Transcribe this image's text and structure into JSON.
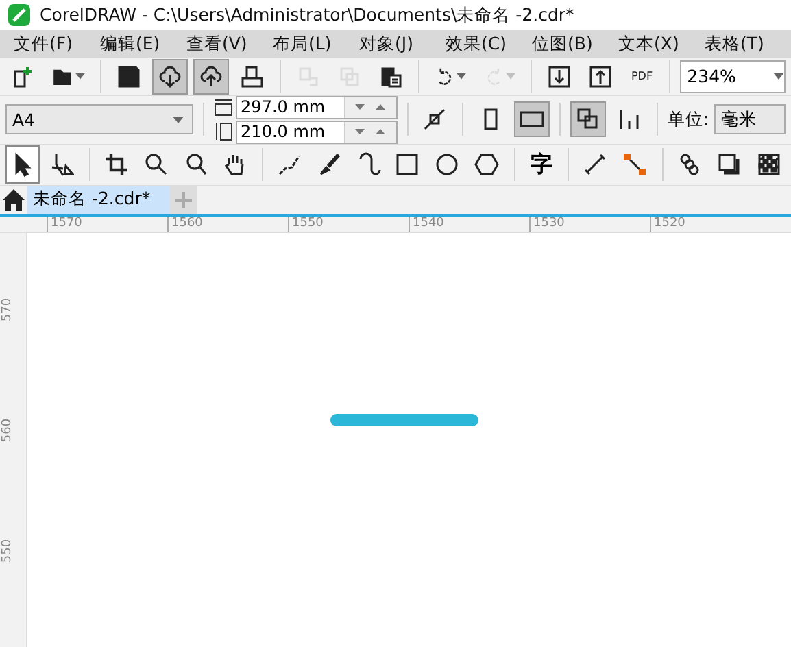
{
  "window": {
    "title": "CorelDRAW - C:\\Users\\Administrator\\Documents\\未命名 -2.cdr*"
  },
  "menu": [
    "文件(F)",
    "编辑(E)",
    "查看(V)",
    "布局(L)",
    "对象(J)",
    "效果(C)",
    "位图(B)",
    "文本(X)",
    "表格(T)"
  ],
  "standard_toolbar": [
    {
      "kind": "new",
      "selected": false,
      "disabled": false
    },
    {
      "kind": "open",
      "selected": false,
      "disabled": false,
      "dropdown": true
    },
    {
      "kind": "sep"
    },
    {
      "kind": "save",
      "selected": false,
      "disabled": false
    },
    {
      "kind": "download",
      "selected": true,
      "disabled": false
    },
    {
      "kind": "upload",
      "selected": true,
      "disabled": false
    },
    {
      "kind": "print",
      "selected": false,
      "disabled": false
    },
    {
      "kind": "sep"
    },
    {
      "kind": "cut",
      "selected": false,
      "disabled": true
    },
    {
      "kind": "copy",
      "selected": false,
      "disabled": true
    },
    {
      "kind": "paste",
      "selected": false,
      "disabled": false
    },
    {
      "kind": "sep"
    },
    {
      "kind": "undo",
      "selected": false,
      "disabled": false,
      "dropdown": true
    },
    {
      "kind": "redo",
      "selected": false,
      "disabled": true,
      "dropdown": true
    },
    {
      "kind": "sep"
    },
    {
      "kind": "import",
      "selected": false,
      "disabled": false
    },
    {
      "kind": "export",
      "selected": false,
      "disabled": false
    },
    {
      "kind": "pdf",
      "selected": false,
      "disabled": false,
      "label": "PDF"
    }
  ],
  "zoom": {
    "value": "234%"
  },
  "property_bar": {
    "page_size": "A4",
    "width": "297.0 mm",
    "height": "210.0 mm",
    "unit_label": "单位:",
    "unit_value": "毫米"
  },
  "toolbox": [
    {
      "kind": "pick",
      "selected": true
    },
    {
      "kind": "shape",
      "selected": false
    },
    {
      "kind": "sep"
    },
    {
      "kind": "crop",
      "selected": false
    },
    {
      "kind": "zoom",
      "selected": false
    },
    {
      "kind": "zoom2",
      "selected": false
    },
    {
      "kind": "pan",
      "selected": false
    },
    {
      "kind": "sep"
    },
    {
      "kind": "curve",
      "selected": false
    },
    {
      "kind": "brush",
      "selected": false
    },
    {
      "kind": "spiral",
      "selected": false
    },
    {
      "kind": "rect",
      "selected": false
    },
    {
      "kind": "ellipse",
      "selected": false
    },
    {
      "kind": "polygon",
      "selected": false
    },
    {
      "kind": "sep"
    },
    {
      "kind": "text",
      "selected": false,
      "label": "字"
    },
    {
      "kind": "sep"
    },
    {
      "kind": "dimension",
      "selected": false
    },
    {
      "kind": "connector",
      "selected": false
    },
    {
      "kind": "sep"
    },
    {
      "kind": "blend",
      "selected": false
    },
    {
      "kind": "shadow",
      "selected": false
    },
    {
      "kind": "transparency",
      "selected": false
    }
  ],
  "document_tabs": [
    {
      "label": "未命名 -2.cdr*",
      "selected": true
    }
  ],
  "rulers": {
    "horizontal": [
      "1570",
      "1560",
      "1550",
      "1540",
      "1530",
      "1520"
    ],
    "vertical": [
      "570",
      "560",
      "550"
    ]
  }
}
